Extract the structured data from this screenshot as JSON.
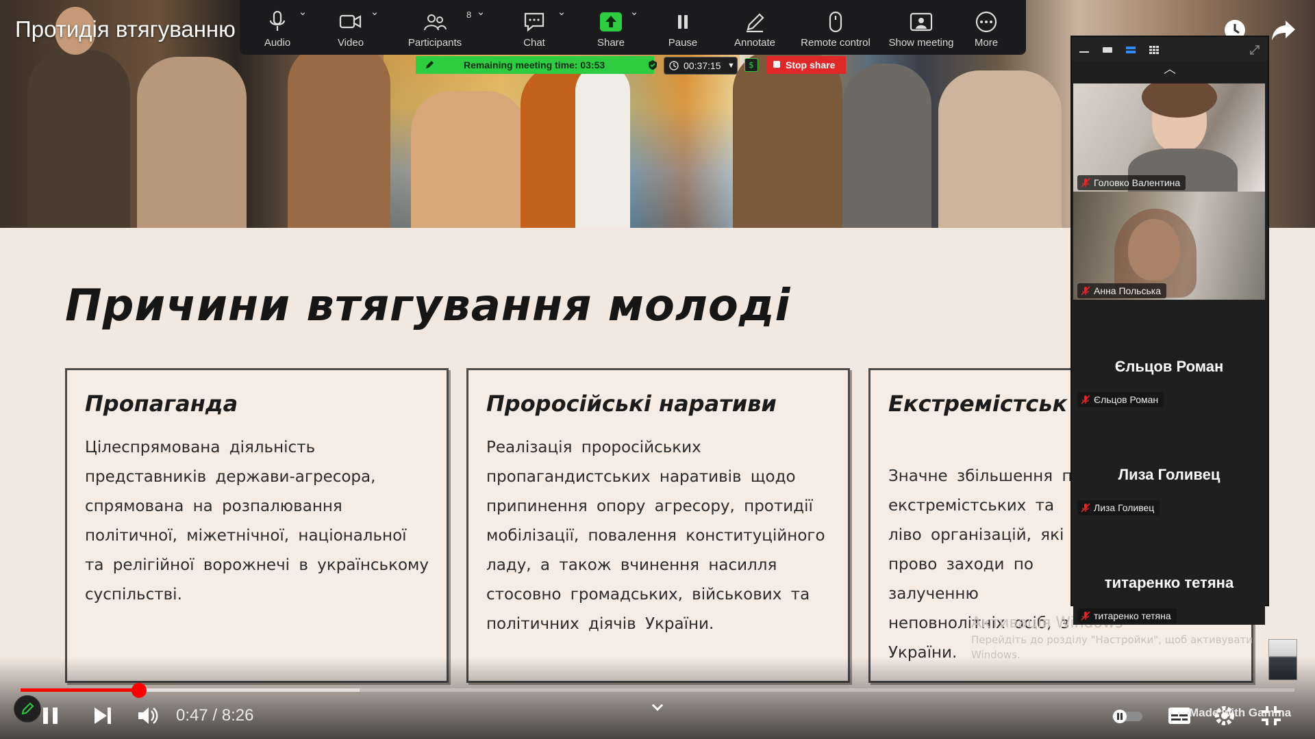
{
  "video": {
    "title": "Протидія втягуванню"
  },
  "zoom_toolbar": {
    "items": [
      {
        "label": "Audio",
        "icon": "microphone-icon"
      },
      {
        "label": "Video",
        "icon": "camera-icon"
      },
      {
        "label": "Participants",
        "icon": "participants-icon",
        "count": "8"
      },
      {
        "label": "Chat",
        "icon": "chat-icon"
      },
      {
        "label": "Share",
        "icon": "share-screen-icon"
      },
      {
        "label": "Pause",
        "icon": "pause-icon"
      },
      {
        "label": "Annotate",
        "icon": "pencil-icon"
      },
      {
        "label": "Remote control",
        "icon": "mouse-icon"
      },
      {
        "label": "Show meeting",
        "icon": "show-meeting-icon"
      },
      {
        "label": "More",
        "icon": "more-icon"
      }
    ],
    "accent_green": "#2ecc40",
    "stop_red": "#e02828"
  },
  "status": {
    "remaining": "Remaining meeting time: 03:53",
    "elapsed": "00:37:15",
    "dollar": "$",
    "stop_share": "Stop share"
  },
  "slide": {
    "heading": "Причини втягування молоді",
    "cards": [
      {
        "title": "Пропаганда",
        "text": "Цілеспрямована діяльність представників держави-агресора, спрямована на розпалювання політичної, міжетнічної, національної та релігійної ворожнечі в українському суспільстві."
      },
      {
        "title": "Проросійські наративи",
        "text": "Реалізація проросійських пропагандистських наративів щодо припинення опору агресору, протидії мобілізації, повалення конституційного ладу, а також вчинення насилля стосовно громадських, військових та політичних діячів України."
      },
      {
        "title": "Екстремістськ",
        "text": "Значне збільшення пр екстремістських та ліво організацій, які прово заходи по залученню неповнолітніх осіб, з України."
      }
    ]
  },
  "watermark": {
    "title": "Активація Windows",
    "line": "Перейдіть до розділу \"Настройки\", щоб активувати Windows."
  },
  "participants": [
    {
      "name": "Головко Валентина",
      "type": "video"
    },
    {
      "name": "Анна Польська",
      "type": "video"
    },
    {
      "name": "Єльцов Роман",
      "type": "name"
    },
    {
      "name": "Лиза Голивец",
      "type": "name"
    },
    {
      "name": "титаренко тетяна",
      "type": "name"
    }
  ],
  "player": {
    "time_current": "0:47",
    "time_total": "8:26",
    "time_label": "0:47 / 8:26",
    "progress_fraction": 0.093,
    "buffered_fraction": 0.266,
    "made_with": "Made with Gamma",
    "progress_color": "#ff0000"
  }
}
